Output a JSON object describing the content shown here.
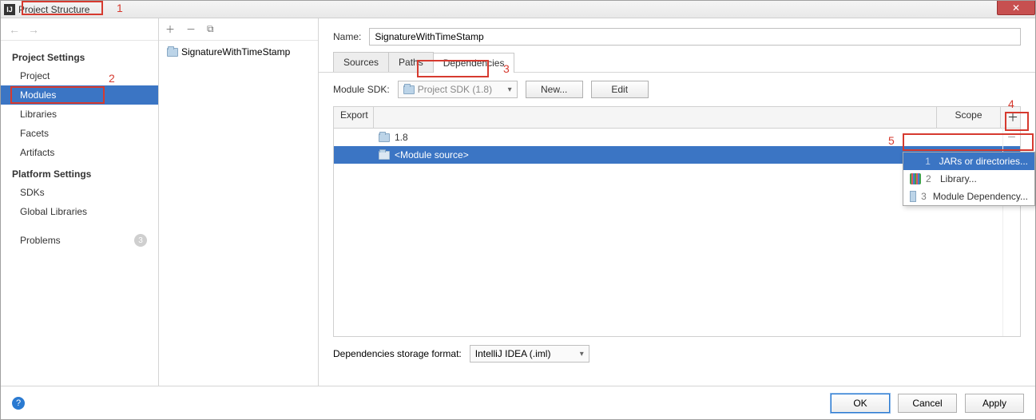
{
  "window": {
    "title": "Project Structure"
  },
  "sidebar": {
    "headings": {
      "project": "Project Settings",
      "platform": "Platform Settings"
    },
    "items": {
      "project": "Project",
      "modules": "Modules",
      "libraries": "Libraries",
      "facets": "Facets",
      "artifacts": "Artifacts",
      "sdks": "SDKs",
      "globalLibs": "Global Libraries",
      "problems": "Problems"
    },
    "problemsCount": "3"
  },
  "modules": {
    "selected": "SignatureWithTimeStamp"
  },
  "main": {
    "nameLabel": "Name:",
    "nameValue": "SignatureWithTimeStamp",
    "tabs": {
      "sources": "Sources",
      "paths": "Paths",
      "dependencies": "Dependencies"
    },
    "sdkLabel": "Module SDK:",
    "sdkValue": "Project SDK (1.8)",
    "newBtn": "New...",
    "editBtn": "Edit",
    "columns": {
      "export": "Export",
      "scope": "Scope"
    },
    "deps": {
      "sdk": "1.8",
      "src": "<Module source>"
    },
    "storageLabel": "Dependencies storage format:",
    "storageValue": "IntelliJ IDEA (.iml)"
  },
  "popup": {
    "jars": "JARs or directories...",
    "library": "Library...",
    "moduleDep": "Module Dependency..."
  },
  "footer": {
    "ok": "OK",
    "cancel": "Cancel",
    "apply": "Apply"
  },
  "annot": {
    "n1": "1",
    "n2": "2",
    "n3": "3",
    "n4": "4",
    "n5": "5"
  }
}
